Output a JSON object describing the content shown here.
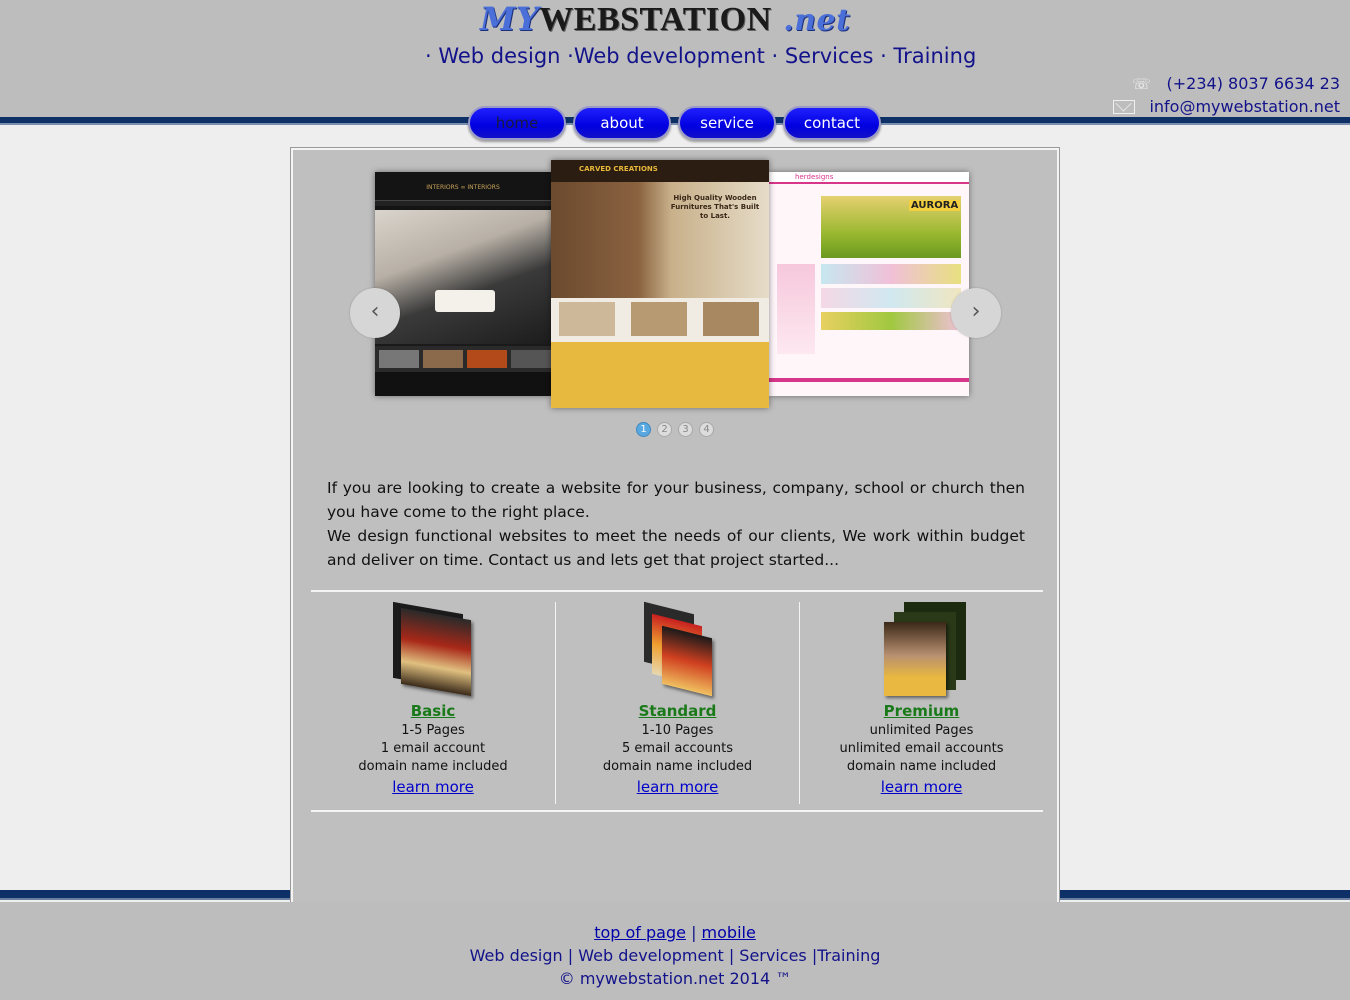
{
  "header": {
    "logo": {
      "my": "MY",
      "webstation": "WEBSTATION",
      "net": ".net"
    },
    "tagline": "· Web design ·Web development · Services · Training",
    "phone": "(+234) 8037 6634 23",
    "email": "info@mywebstation.net"
  },
  "nav": [
    {
      "label": "home"
    },
    {
      "label": "about"
    },
    {
      "label": "service"
    },
    {
      "label": "contact"
    }
  ],
  "carousel": {
    "prev": "‹",
    "next": "›",
    "slides": {
      "left": {
        "brand": "INTERIORS ∞ INTERIORS"
      },
      "center": {
        "brand": "CARVED CREATIONS",
        "headline": "High Quality Wooden Furnitures That's Built to Last."
      },
      "right": {
        "brand": "herdesigns",
        "headline": "AURORA"
      }
    },
    "dots": [
      "1",
      "2",
      "3",
      "4"
    ]
  },
  "intro": {
    "line1": "If you are looking to create a website for your business, company, school or church then you have come to the right place.",
    "line2": "We design functional websites to meet the needs of our clients, We work within budget and deliver on time. Contact us and lets get that project started..."
  },
  "packages": [
    {
      "title": "Basic",
      "pages": "1-5 Pages",
      "email": "1 email account",
      "domain": "domain name included",
      "more": "learn more"
    },
    {
      "title": "Standard",
      "pages": "1-10 Pages",
      "email": "5 email accounts",
      "domain": "domain name included",
      "more": "learn more"
    },
    {
      "title": "Premium",
      "pages": "unlimited Pages",
      "email": "unlimited email accounts",
      "domain": "domain name included",
      "more": "learn more"
    }
  ],
  "footer": {
    "top_link": "top of page",
    "sep": "|",
    "mobile_link": "mobile",
    "services_line": "Web design | Web development | Services |Training",
    "copyright": "© mywebstation.net 2014 ™"
  },
  "colors": {
    "header_bg": "#bdbdbd",
    "stripe": "#0d3166",
    "nav_btn": "#0000e0",
    "link_green": "#1a7a1a",
    "link_blue": "#0000cc",
    "text_navy": "#12128a"
  }
}
